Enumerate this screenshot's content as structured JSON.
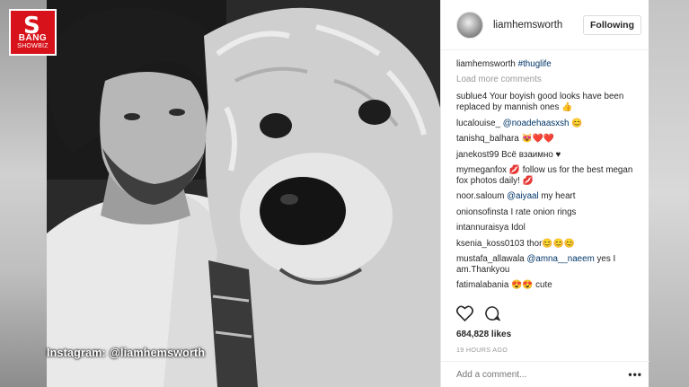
{
  "logo": {
    "letter": "S",
    "line1": "BANG",
    "line2": "SHOWBIZ"
  },
  "photo_caption": "Instagram: @liamhemsworth",
  "post": {
    "username": "liamhemsworth",
    "follow_label": "Following",
    "caption_user": "liamhemsworth",
    "caption_tag": "#thuglife",
    "load_more": "Load more comments",
    "comments": [
      {
        "user": "sublue4",
        "text": "Your boyish good looks have been replaced by mannish ones 👍"
      },
      {
        "user": "lucalouise_",
        "text": "😊",
        "mention": "@noadehaasxsh"
      },
      {
        "user": "tanishq_balhara",
        "text": "😻❤️❤️"
      },
      {
        "user": "janekost99",
        "text": "Всё взаимно ♥"
      },
      {
        "user": "mymeganfox",
        "text": "💋 follow us for the best megan fox photos daily! 💋"
      },
      {
        "user": "noor.saloum",
        "text": "my heart",
        "mention": "@aiyaal"
      },
      {
        "user": "onionsofinsta",
        "text": "I rate onion rings"
      },
      {
        "user": "intannuraisya",
        "text": "Idol"
      },
      {
        "user": "ksenia_koss0103",
        "text": "thor😊😊😊"
      },
      {
        "user": "mustafa_allawala",
        "text": "yes I am.Thankyou",
        "mention": "@amna__naeem"
      },
      {
        "user": "fatimalabania",
        "text": "😍😍 cute"
      }
    ],
    "likes": "684,828 likes",
    "timestamp": "19 HOURS AGO",
    "add_comment_placeholder": "Add a comment...",
    "more_options": "•••"
  },
  "icons": {
    "like": "heart-icon",
    "comment": "speech-bubble-icon",
    "more": "ellipsis-icon"
  },
  "colors": {
    "logo_red": "#d8121a",
    "link": "#003569",
    "muted": "#999999",
    "text": "#262626"
  }
}
